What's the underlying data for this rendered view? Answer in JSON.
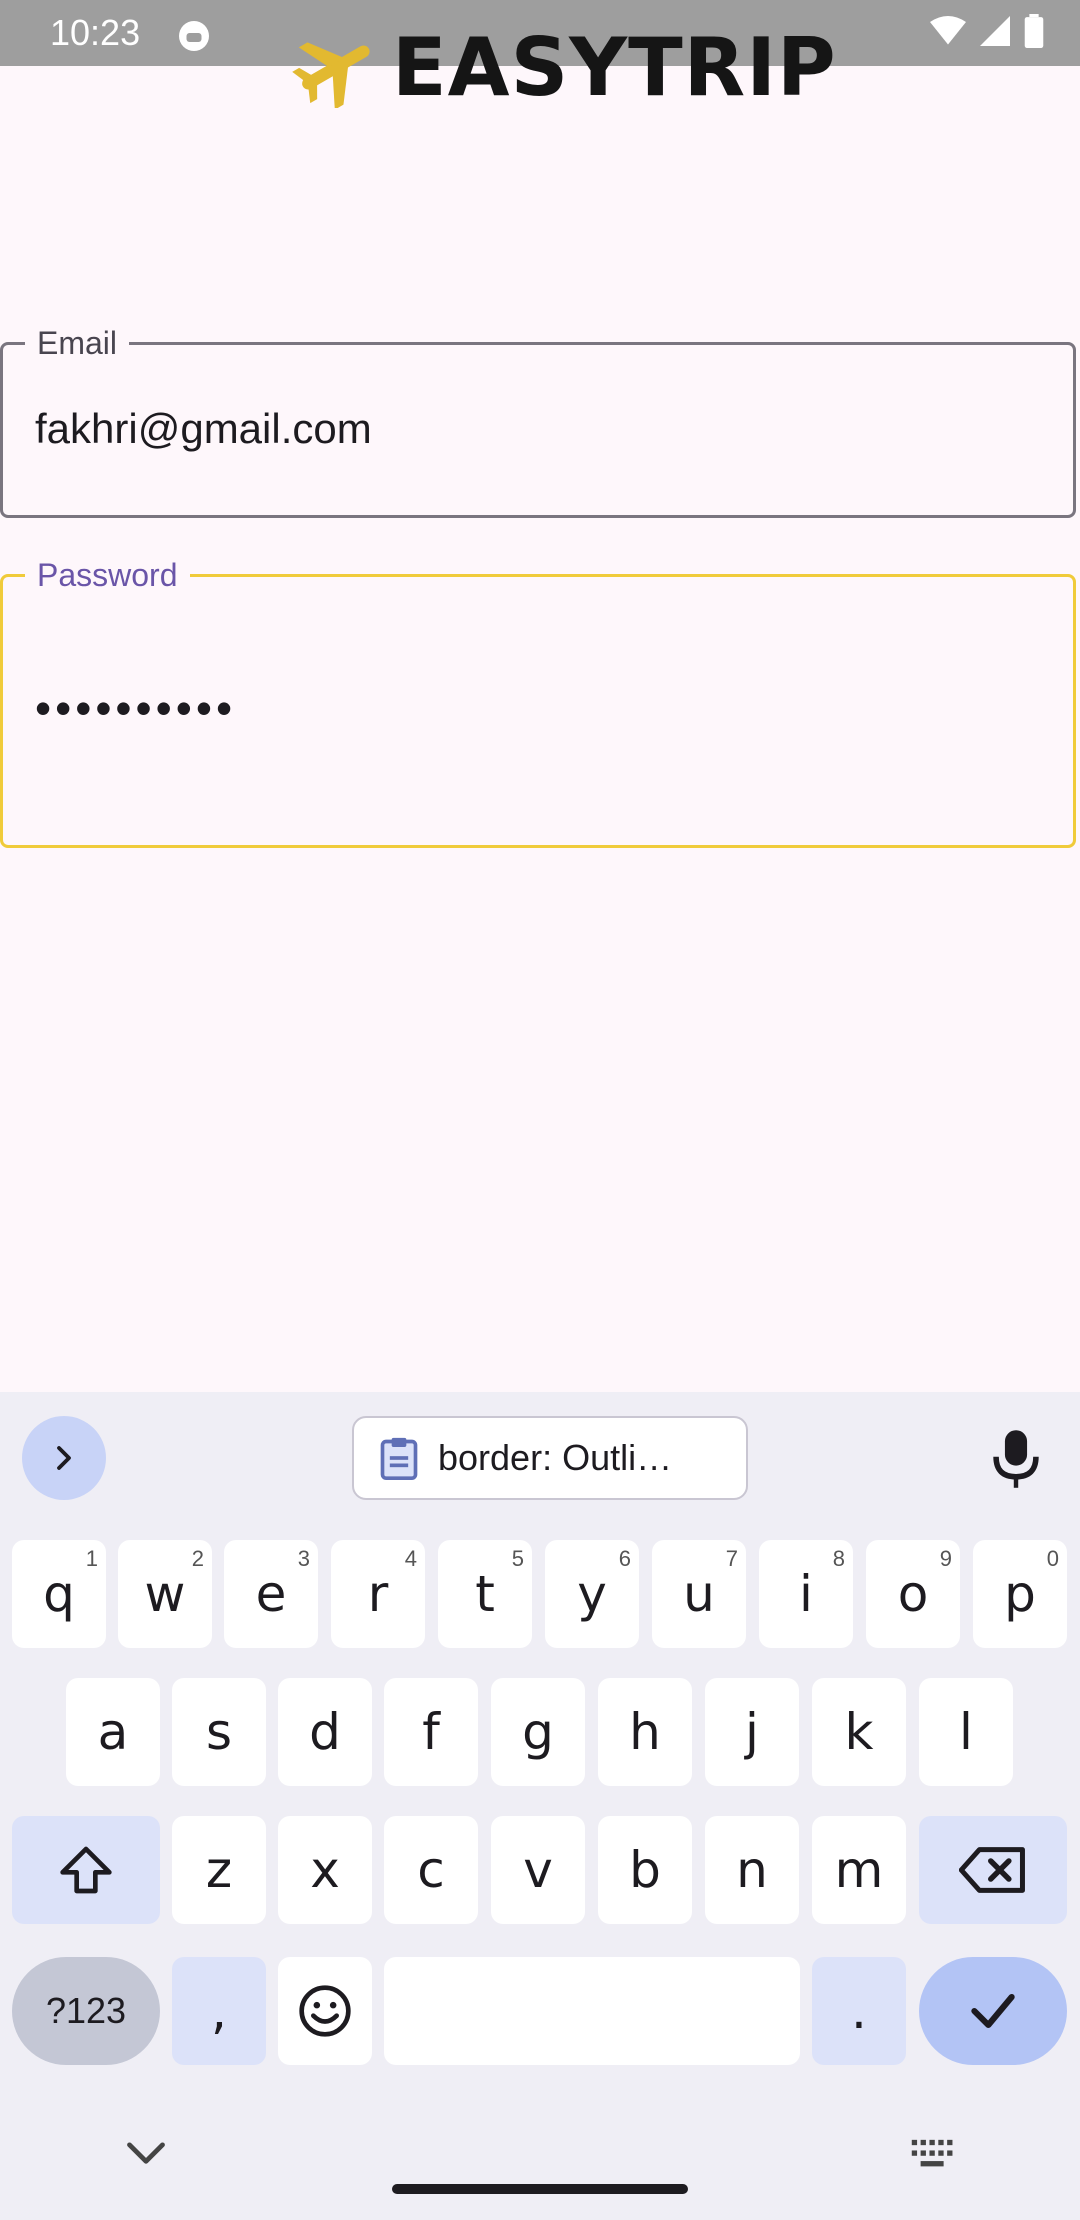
{
  "status_bar": {
    "time": "10:23"
  },
  "app": {
    "logo_text": "EASYTRIP",
    "brand_color": "#E2B930"
  },
  "form": {
    "email": {
      "label": "Email",
      "value": "fakhri@gmail.com"
    },
    "password": {
      "label": "Password",
      "value": "••••••••••",
      "focus_color": "#F0CB3A"
    }
  },
  "keyboard": {
    "clipboard_suggestion": "border: Outli…",
    "row1": [
      {
        "k": "q",
        "h": "1"
      },
      {
        "k": "w",
        "h": "2"
      },
      {
        "k": "e",
        "h": "3"
      },
      {
        "k": "r",
        "h": "4"
      },
      {
        "k": "t",
        "h": "5"
      },
      {
        "k": "y",
        "h": "6"
      },
      {
        "k": "u",
        "h": "7"
      },
      {
        "k": "i",
        "h": "8"
      },
      {
        "k": "o",
        "h": "9"
      },
      {
        "k": "p",
        "h": "0"
      }
    ],
    "row2": [
      "a",
      "s",
      "d",
      "f",
      "g",
      "h",
      "j",
      "k",
      "l"
    ],
    "row3": [
      "z",
      "x",
      "c",
      "v",
      "b",
      "n",
      "m"
    ],
    "symbols_label": "?123",
    "comma": ",",
    "period": "."
  }
}
